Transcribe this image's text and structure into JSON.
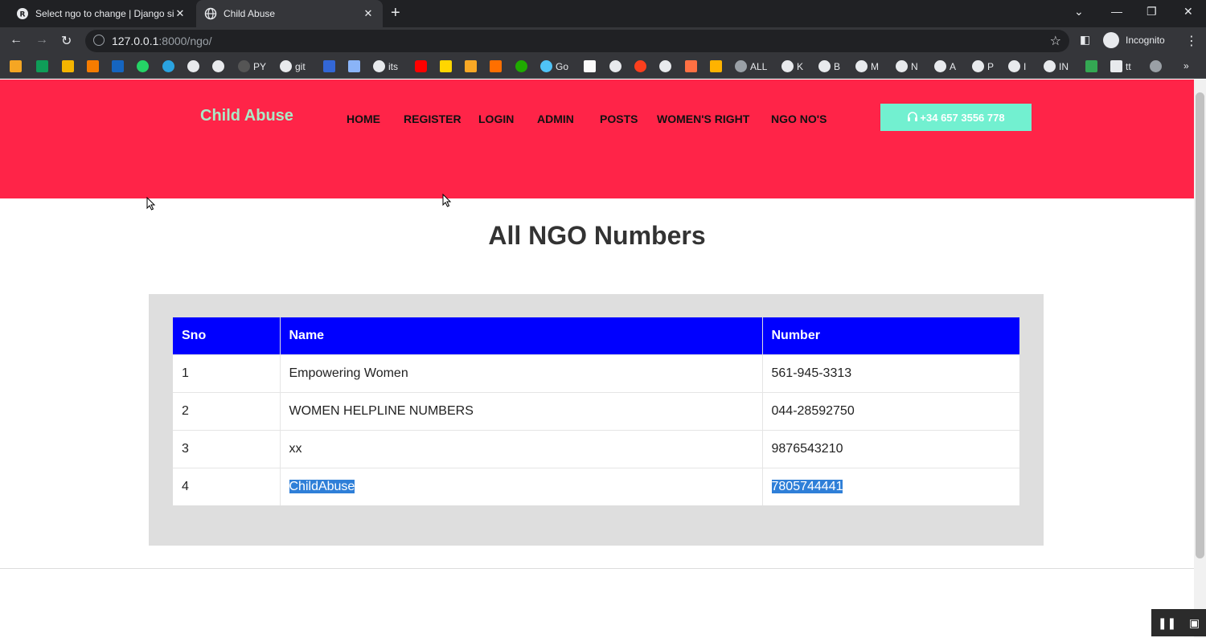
{
  "browser": {
    "tabs": [
      {
        "title": "Select ngo to change | Django sit",
        "active": false
      },
      {
        "title": "Child Abuse",
        "active": true
      }
    ],
    "url_host": "127.0.0.1",
    "url_rest": ":8000/ngo/",
    "profile_label": "Incognito",
    "bookmarks": [
      "PY",
      "git",
      "its",
      "Go",
      "ALL",
      "K",
      "B",
      "M",
      "N",
      "A",
      "P",
      "I",
      "IN",
      "tt"
    ],
    "more_bookmarks": "»"
  },
  "site": {
    "brand": "Child Abuse",
    "nav": [
      "HOME",
      "REGISTER",
      "LOGIN",
      "ADMIN",
      "POSTS",
      "WOMEN'S RIGHT",
      "NGO NO'S"
    ],
    "phone": "+34 657 3556 778",
    "hero_color": "#ff2448",
    "accent_color": "#72f0d0"
  },
  "main": {
    "title": "All NGO Numbers",
    "table": {
      "headers": [
        "Sno",
        "Name",
        "Number"
      ],
      "header_color": "#0000ff",
      "rows": [
        {
          "sno": "1",
          "name": "Empowering Women",
          "number": "561-945-3313"
        },
        {
          "sno": "2",
          "name": "WOMEN HELPLINE NUMBERS",
          "number": "044-28592750"
        },
        {
          "sno": "3",
          "name": "xx",
          "number": "9876543210"
        },
        {
          "sno": "4",
          "name": "ChildAbuse",
          "number": "7805744441"
        }
      ]
    }
  }
}
